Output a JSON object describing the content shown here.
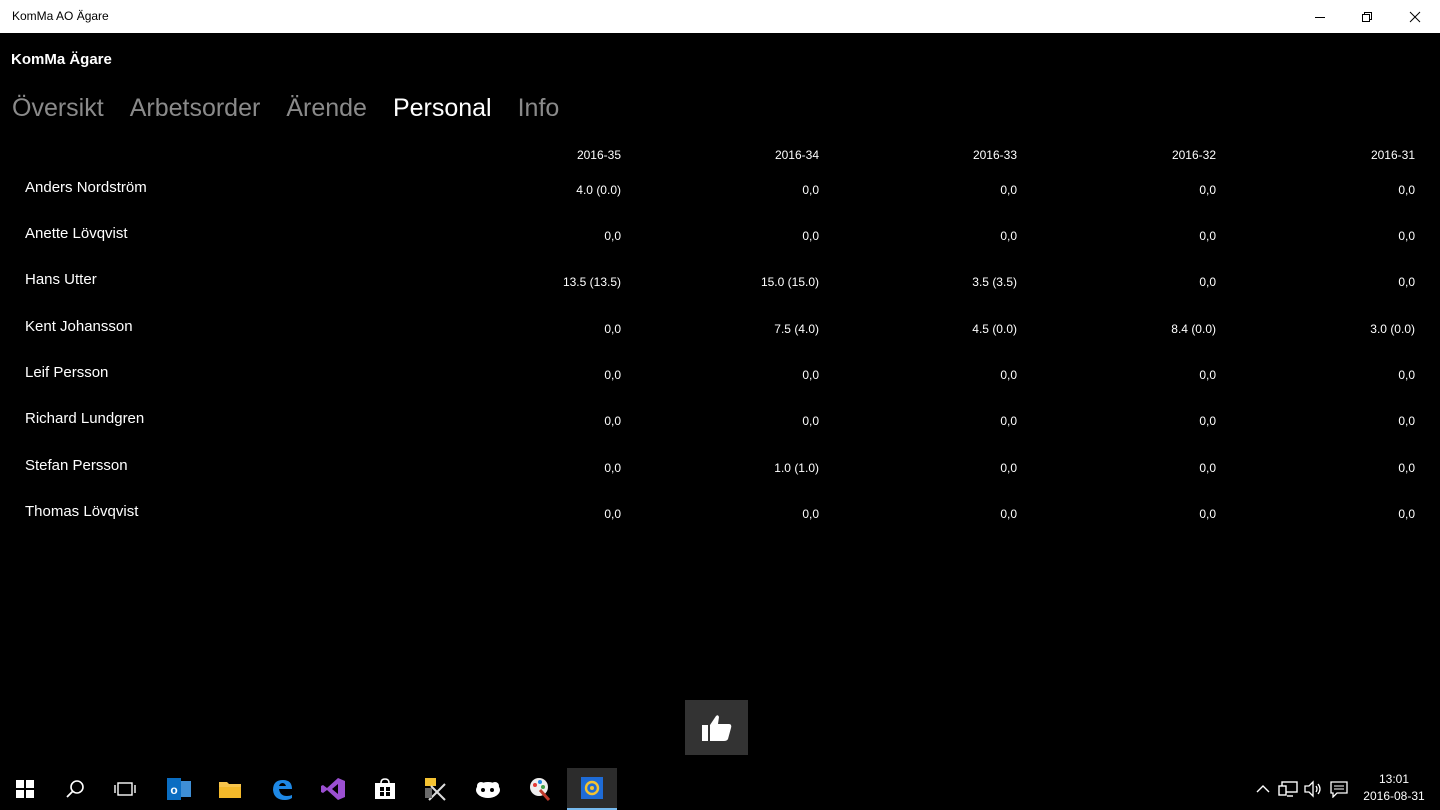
{
  "window": {
    "title": "KomMa AO Ägare"
  },
  "app": {
    "brand": "KomMa Ägare"
  },
  "tabs": [
    {
      "label": "Översikt",
      "active": false
    },
    {
      "label": "Arbetsorder",
      "active": false
    },
    {
      "label": "Ärende",
      "active": false
    },
    {
      "label": "Personal",
      "active": true
    },
    {
      "label": "Info",
      "active": false
    }
  ],
  "table": {
    "weeks": [
      "2016-35",
      "2016-34",
      "2016-33",
      "2016-32",
      "2016-31"
    ],
    "rows": [
      {
        "name": "Anders Nordström",
        "values": [
          "4.0 (0.0)",
          "0,0",
          "0,0",
          "0,0",
          "0,0"
        ]
      },
      {
        "name": "Anette Lövqvist",
        "values": [
          "0,0",
          "0,0",
          "0,0",
          "0,0",
          "0,0"
        ]
      },
      {
        "name": "Hans Utter",
        "values": [
          "13.5 (13.5)",
          "15.0 (15.0)",
          "3.5 (3.5)",
          "0,0",
          "0,0"
        ]
      },
      {
        "name": "Kent Johansson",
        "values": [
          "0,0",
          "7.5 (4.0)",
          "4.5 (0.0)",
          "8.4 (0.0)",
          "3.0 (0.0)"
        ]
      },
      {
        "name": "Leif Persson",
        "values": [
          "0,0",
          "0,0",
          "0,0",
          "0,0",
          "0,0"
        ]
      },
      {
        "name": "Richard Lundgren",
        "values": [
          "0,0",
          "0,0",
          "0,0",
          "0,0",
          "0,0"
        ]
      },
      {
        "name": "Stefan Persson",
        "values": [
          "0,0",
          "1.0 (1.0)",
          "0,0",
          "0,0",
          "0,0"
        ]
      },
      {
        "name": "Thomas Lövqvist",
        "values": [
          "0,0",
          "0,0",
          "0,0",
          "0,0",
          "0,0"
        ]
      }
    ]
  },
  "like_button": {
    "icon": "thumbs-up-icon"
  },
  "taskbar": {
    "apps": [
      "windows-start-icon",
      "search-icon",
      "task-view-icon",
      "outlook-icon",
      "file-explorer-icon",
      "edge-icon",
      "visual-studio-icon",
      "store-icon",
      "tool-icon",
      "app-icon",
      "paint-icon",
      "komma-app-icon"
    ],
    "clock": {
      "time": "13:01",
      "date": "2016-08-31"
    }
  },
  "colors": {
    "accent": "#76b9ed",
    "tab_inactive": "#8a8a8a",
    "background": "#000000"
  }
}
